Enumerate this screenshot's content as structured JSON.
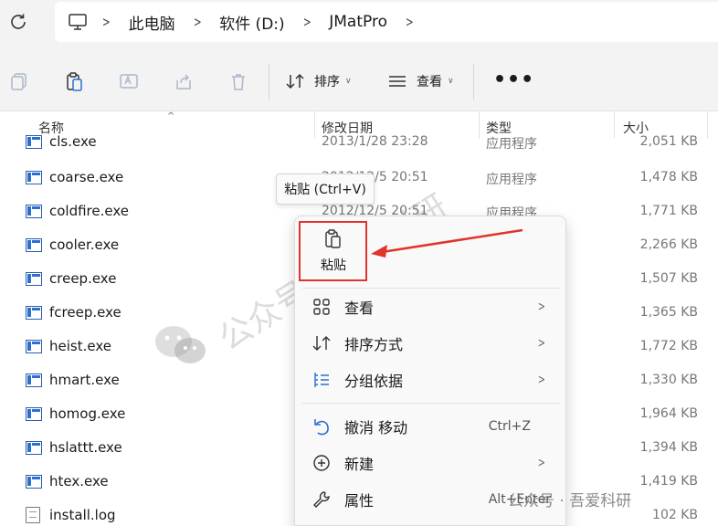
{
  "address_bar": {
    "breadcrumbs": [
      "此电脑",
      "软件 (D:)",
      "JMatPro"
    ]
  },
  "toolbar": {
    "sort_label": "排序",
    "view_label": "查看"
  },
  "columns": {
    "name": "名称",
    "date": "修改日期",
    "type": "类型",
    "size": "大小"
  },
  "files": [
    {
      "name": "cls.exe",
      "date": "2013/1/28 23:28",
      "type": "应用程序",
      "size": "2,051 KB",
      "icon": "exe"
    },
    {
      "name": "coarse.exe",
      "date": "2012/12/5 20:51",
      "type": "应用程序",
      "size": "1,478 KB",
      "icon": "exe"
    },
    {
      "name": "coldfire.exe",
      "date": "2012/12/5 20:51",
      "type": "应用程序",
      "size": "1,771 KB",
      "icon": "exe"
    },
    {
      "name": "cooler.exe",
      "date": "",
      "type": "",
      "size": "2,266 KB",
      "icon": "exe"
    },
    {
      "name": "creep.exe",
      "date": "",
      "type": "",
      "size": "1,507 KB",
      "icon": "exe"
    },
    {
      "name": "fcreep.exe",
      "date": "",
      "type": "",
      "size": "1,365 KB",
      "icon": "exe"
    },
    {
      "name": "heist.exe",
      "date": "",
      "type": "",
      "size": "1,772 KB",
      "icon": "exe"
    },
    {
      "name": "hmart.exe",
      "date": "",
      "type": "",
      "size": "1,330 KB",
      "icon": "exe"
    },
    {
      "name": "homog.exe",
      "date": "",
      "type": "",
      "size": "1,964 KB",
      "icon": "exe"
    },
    {
      "name": "hslattt.exe",
      "date": "",
      "type": "",
      "size": "1,394 KB",
      "icon": "exe"
    },
    {
      "name": "htex.exe",
      "date": "",
      "type": "",
      "size": "1,419 KB",
      "icon": "exe"
    },
    {
      "name": "install.log",
      "date": "",
      "type": "",
      "size": "102 KB",
      "icon": "doc"
    }
  ],
  "tooltip": {
    "text": "粘贴 (Ctrl+V)"
  },
  "context_menu": {
    "paste_label": "粘贴",
    "items": [
      {
        "label": "查看",
        "shortcut": "",
        "submenu": true,
        "icon": "grid-icon"
      },
      {
        "label": "排序方式",
        "shortcut": "",
        "submenu": true,
        "icon": "sort-icon"
      },
      {
        "label": "分组依据",
        "shortcut": "",
        "submenu": true,
        "icon": "group-icon"
      },
      {
        "label": "撤消 移动",
        "shortcut": "Ctrl+Z",
        "submenu": false,
        "icon": "undo-icon"
      },
      {
        "label": "新建",
        "shortcut": "",
        "submenu": true,
        "icon": "new-icon"
      },
      {
        "label": "属性",
        "shortcut": "Alt+Enter",
        "submenu": false,
        "icon": "properties-icon"
      }
    ]
  },
  "watermark": {
    "diagonal": "公众号 · 吾爱科研",
    "footer": "公众号 · 吾爱科研"
  },
  "colors": {
    "highlight_border": "#e0342a",
    "arrow": "#e0342a",
    "exe_icon": "#2a6fd1"
  }
}
